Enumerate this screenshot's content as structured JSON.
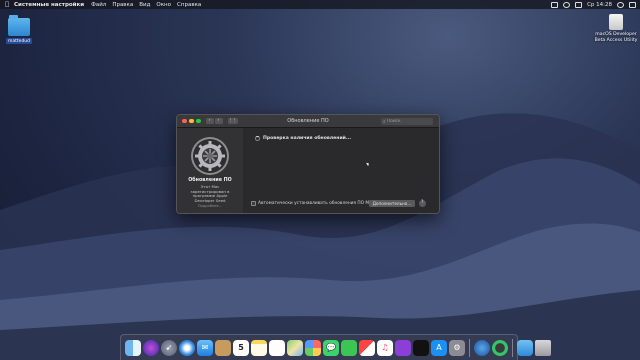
{
  "menubar": {
    "app_name": "Системные настройки",
    "menus": [
      "Файл",
      "Правка",
      "Вид",
      "Окно",
      "Справка"
    ],
    "clock": "Ср 14:28"
  },
  "desktop": {
    "icons": [
      {
        "label": "mattedud",
        "icon": "folder-icon"
      },
      {
        "label": "macOS Developer Beta Access Utility",
        "icon": "disk-icon"
      }
    ]
  },
  "window": {
    "title": "Обновление ПО",
    "search_placeholder": "Поиск",
    "sidebar": {
      "title": "Обновление ПО",
      "description": "Этот Mac зарегистрирован в программе Apple Developer Seed",
      "details_link": "Подробнее..."
    },
    "status_text": "Проверка наличия обновлений...",
    "auto_update_label": "Автоматически устанавливать обновления ПО Mac",
    "auto_update_checked": false,
    "advanced_button": "Дополнительно...",
    "help_button": "?"
  },
  "dock": {
    "calendar_day": "5",
    "apps": [
      "finder-icon",
      "siri-icon",
      "launchpad-icon",
      "safari-icon",
      "mail-icon",
      "contacts-icon",
      "calendar-icon",
      "notes-icon",
      "reminders-icon",
      "maps-icon",
      "photos-icon",
      "messages-icon",
      "facetime-icon",
      "news-icon",
      "music-icon",
      "podcasts-icon",
      "tv-icon",
      "app-store-icon",
      "system-preferences-icon",
      "quicktime-icon",
      "screen-time-icon",
      "downloads-folder-icon",
      "trash-icon"
    ]
  }
}
